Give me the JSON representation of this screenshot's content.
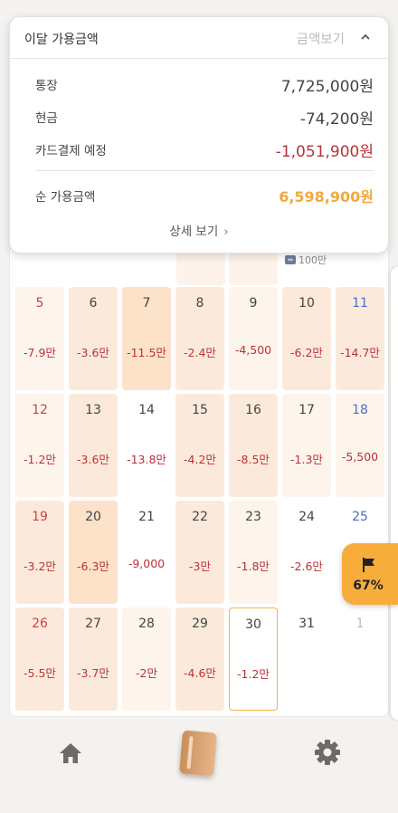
{
  "summary": {
    "title": "이달 가용금액",
    "toggle_label": "금액보기",
    "rows": [
      {
        "label": "통장",
        "value": "7,725,000원"
      },
      {
        "label": "현금",
        "value": "-74,200원"
      },
      {
        "label": "카드결제 예정",
        "value": "-1,051,900원"
      }
    ],
    "net_label": "순 가용금액",
    "net_value": "6,598,900원",
    "detail_label": "상세 보기"
  },
  "calendar": {
    "peek_badge": "100만",
    "weeks": [
      [
        {
          "day": "5",
          "amount": "-7.9만"
        },
        {
          "day": "6",
          "amount": "-3.6만"
        },
        {
          "day": "7",
          "amount": "-11.5만"
        },
        {
          "day": "8",
          "amount": "-2.4만"
        },
        {
          "day": "9",
          "amount": "-4,500"
        },
        {
          "day": "10",
          "amount": "-6.2만"
        },
        {
          "day": "11",
          "amount": "-14.7만"
        }
      ],
      [
        {
          "day": "12",
          "amount": "-1.2만"
        },
        {
          "day": "13",
          "amount": "-3.6만"
        },
        {
          "day": "14",
          "amount": "-13.8만"
        },
        {
          "day": "15",
          "amount": "-4.2만"
        },
        {
          "day": "16",
          "amount": "-8.5만"
        },
        {
          "day": "17",
          "amount": "-1.3만"
        },
        {
          "day": "18",
          "amount": "-5,500"
        }
      ],
      [
        {
          "day": "19",
          "amount": "-3.2만"
        },
        {
          "day": "20",
          "amount": "-6.3만"
        },
        {
          "day": "21",
          "amount": "-9,000"
        },
        {
          "day": "22",
          "amount": "-3만"
        },
        {
          "day": "23",
          "amount": "-1.8만"
        },
        {
          "day": "24",
          "amount": "-2.6만"
        },
        {
          "day": "25",
          "amount": ""
        }
      ],
      [
        {
          "day": "26",
          "amount": "-5.5만"
        },
        {
          "day": "27",
          "amount": "-3.7만"
        },
        {
          "day": "28",
          "amount": "-2만"
        },
        {
          "day": "29",
          "amount": "-4.6만"
        },
        {
          "day": "30",
          "amount": "-1.2만"
        },
        {
          "day": "31",
          "amount": ""
        },
        {
          "day": "1",
          "amount": ""
        }
      ]
    ],
    "today": "30"
  },
  "goal": {
    "percent": "67%",
    "icon": "flag-icon"
  },
  "nav": {
    "home_icon": "home-icon",
    "book_icon": "book-icon",
    "settings_icon": "gear-icon"
  },
  "colors": {
    "accent": "#f6ad3c",
    "negative": "#b8323a",
    "saturday": "#4a6fc4",
    "sunday": "#c9424a"
  }
}
